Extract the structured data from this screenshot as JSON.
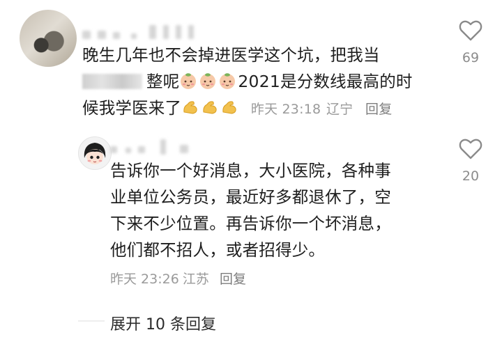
{
  "comment": {
    "text_line1": "晚生几年也不会掉进医学这个坑，把我当",
    "text_line2_after_censor": "整呢",
    "text_line2_tail": "2021是分数线最高的时",
    "text_line3": "候我学医来了",
    "emoji_face": "peach-face-emoji",
    "emoji_arm": "flexed-biceps-emoji",
    "time": "昨天 23:18",
    "location": "辽宁",
    "reply_label": "回复",
    "likes": "69"
  },
  "reply": {
    "lines": [
      "告诉你一个好消息，大小医院，各种事",
      "业单位公务员，最近好多都退休了，空",
      "下来不少位置。再告诉你一个坏消息，",
      "他们都不招人，或者招得少。"
    ],
    "time": "昨天 23:26",
    "location": "江苏",
    "reply_label": "回复",
    "likes": "20"
  },
  "expand_label": "展开 10 条回复",
  "colors": {
    "text": "#1e1e1e",
    "meta": "#9a9a9a",
    "heart": "#8a8a8a",
    "background": "#ffffff"
  }
}
